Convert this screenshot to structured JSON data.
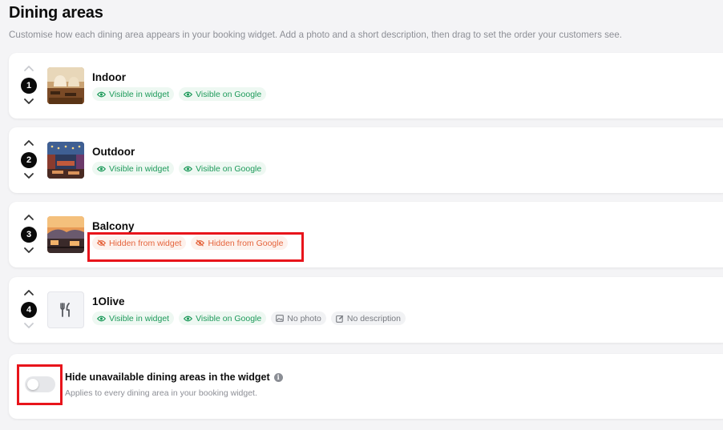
{
  "page": {
    "title": "Dining areas",
    "subtitle": "Customise how each dining area appears in your booking widget. Add a photo and a short description, then drag to set the order your customers see."
  },
  "areas": [
    {
      "position": "1",
      "name": "Indoor",
      "thumbnail": "indoor-photo",
      "badges": [
        {
          "label": "Visible in widget",
          "icon": "eye-icon",
          "tone": "green"
        },
        {
          "label": "Visible on Google",
          "icon": "eye-icon",
          "tone": "green"
        }
      ]
    },
    {
      "position": "2",
      "name": "Outdoor",
      "thumbnail": "outdoor-photo",
      "badges": [
        {
          "label": "Visible in widget",
          "icon": "eye-icon",
          "tone": "green"
        },
        {
          "label": "Visible on Google",
          "icon": "eye-icon",
          "tone": "green"
        }
      ]
    },
    {
      "position": "3",
      "name": "Balcony",
      "thumbnail": "balcony-photo",
      "badges": [
        {
          "label": "Hidden from widget",
          "icon": "eye-off-icon",
          "tone": "red"
        },
        {
          "label": "Hidden from Google",
          "icon": "eye-off-icon",
          "tone": "red"
        }
      ]
    },
    {
      "position": "4",
      "name": "1Olive",
      "thumbnail": "fork-knife-icon",
      "badges": [
        {
          "label": "Visible in widget",
          "icon": "eye-icon",
          "tone": "green"
        },
        {
          "label": "Visible on Google",
          "icon": "eye-icon",
          "tone": "green"
        },
        {
          "label": "No photo",
          "icon": "image-icon",
          "tone": "gray"
        },
        {
          "label": "No description",
          "icon": "edit-icon",
          "tone": "gray"
        }
      ]
    }
  ],
  "hide_unavailable": {
    "label": "Hide unavailable dining areas in the widget",
    "help": "Applies to every dining area in your booking widget.",
    "enabled": false
  },
  "colors": {
    "visible": "#1d9a5a",
    "hidden": "#e5643c",
    "highlight": "#e8141b"
  }
}
